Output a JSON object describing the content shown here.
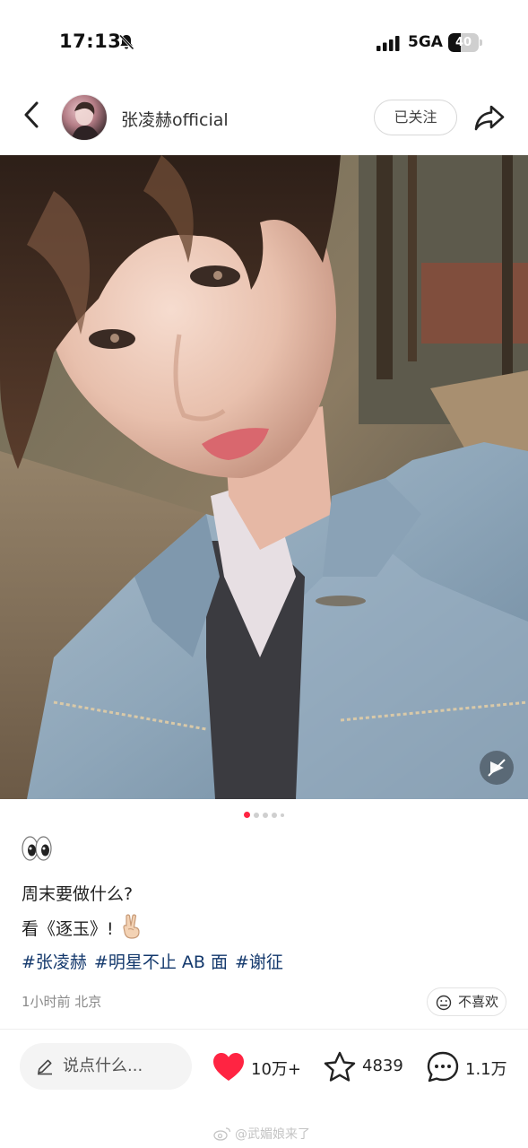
{
  "status_bar": {
    "time": "17:13",
    "network": "5GA",
    "battery": "40",
    "battery_level": 0.4,
    "icons": [
      "mute-bell-icon",
      "signal-icon",
      "battery-icon"
    ]
  },
  "header": {
    "author_name": "张凌赫official",
    "follow_label": "已关注",
    "icons": [
      "back-chevron-icon",
      "share-arrow-icon"
    ]
  },
  "gallery": {
    "page_count": 5,
    "current_page": 1
  },
  "post": {
    "emoji": "eyes",
    "line1": "周末要做什么?",
    "line2": "看《逐玉》!",
    "line2_emoji": "victory-hand",
    "tags": [
      "#张凌赫",
      "#明星不止 AB 面",
      "#谢征"
    ],
    "time_location": "1小时前 北京",
    "dislike_label": "不喜欢"
  },
  "bottom_bar": {
    "comment_placeholder": "说点什么...",
    "likes": "10万+",
    "collects": "4839",
    "comments": "1.1万"
  },
  "watermark": "@武媚娘来了",
  "colors": {
    "accent": "#ff2442",
    "hashtag": "#13386c",
    "meta": "#8a8a8a"
  }
}
